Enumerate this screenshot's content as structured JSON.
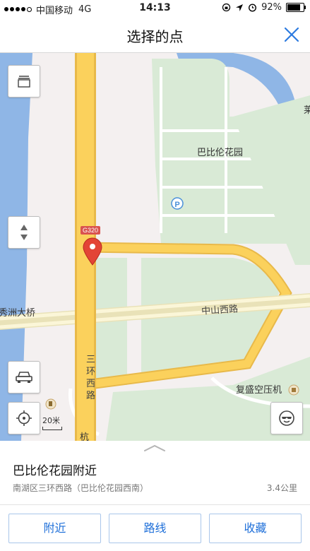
{
  "status_bar": {
    "carrier": "中国移动",
    "network": "4G",
    "time": "14:13",
    "battery": "92%",
    "battery_level": 0.92
  },
  "nav": {
    "title": "选择的点"
  },
  "map": {
    "labels": {
      "park_area": "巴比伦花园",
      "parking": "P",
      "highway_shield": "G320",
      "bridge": "秀洲大桥",
      "road_zhongshan": "中山西路",
      "road_sanhuan": "三环西路",
      "company": "复盛空压机",
      "partial_bottom": "杭",
      "partial_right": "莱"
    },
    "scale": "20米"
  },
  "place": {
    "name": "巴比伦花园附近",
    "address": "南湖区三环西路（巴比伦花园西南）",
    "distance": "3.4公里"
  },
  "actions": {
    "nearby": "附近",
    "route": "路线",
    "favorite": "收藏"
  },
  "colors": {
    "accent": "#1e6fd9",
    "road": "#fbd15c",
    "water": "#8fb6e6",
    "green": "#d9ead6",
    "pin": "#e34436"
  }
}
